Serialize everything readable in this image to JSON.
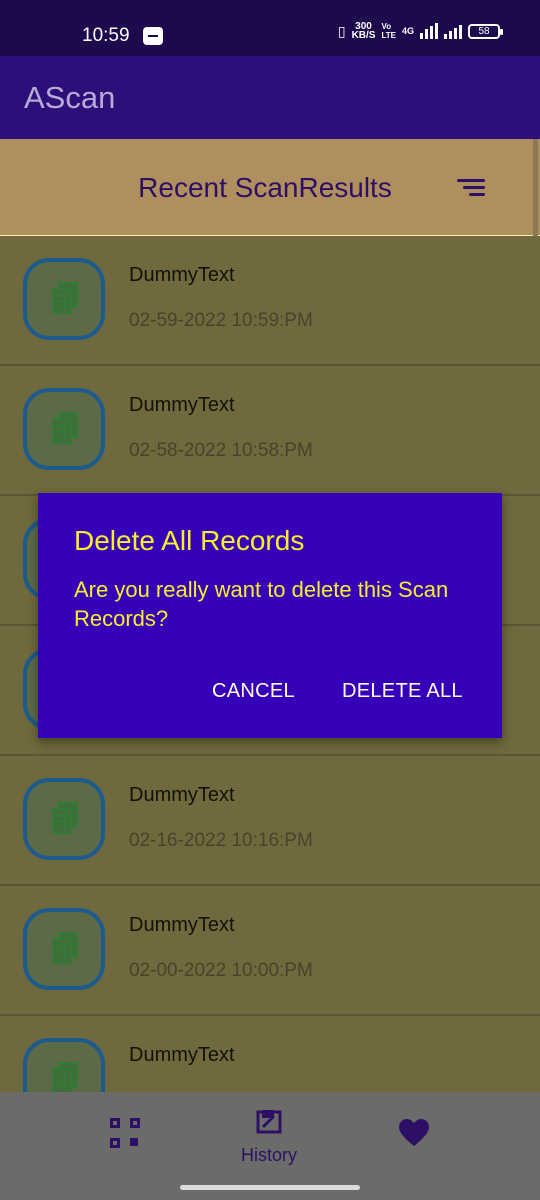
{
  "status_bar": {
    "time": "10:59",
    "speed_top": "300",
    "speed_bottom": "KB/S",
    "volte_top": "Vo",
    "volte_bottom": "LTE",
    "network": "4G",
    "battery": "58"
  },
  "app_bar": {
    "title": "AScan"
  },
  "header": {
    "title": "Recent ScanResults"
  },
  "records": [
    {
      "name": "DummyText",
      "date": "02-59-2022 10:59:PM"
    },
    {
      "name": "DummyText",
      "date": "02-58-2022 10:58:PM"
    },
    {
      "name": "",
      "date": ""
    },
    {
      "name": "",
      "date": ""
    },
    {
      "name": "DummyText",
      "date": "02-16-2022 10:16:PM"
    },
    {
      "name": "DummyText",
      "date": "02-00-2022 10:00:PM"
    },
    {
      "name": "DummyText",
      "date": ""
    }
  ],
  "dialog": {
    "title": "Delete All Records",
    "message": "Are you really want to delete this Scan Records?",
    "cancel_label": "CANCEL",
    "confirm_label": "DELETE ALL"
  },
  "bottom_nav": {
    "items": [
      {
        "icon": "qr-scan-icon",
        "label": ""
      },
      {
        "icon": "history-icon",
        "label": "History"
      },
      {
        "icon": "heart-icon",
        "label": ""
      }
    ]
  }
}
